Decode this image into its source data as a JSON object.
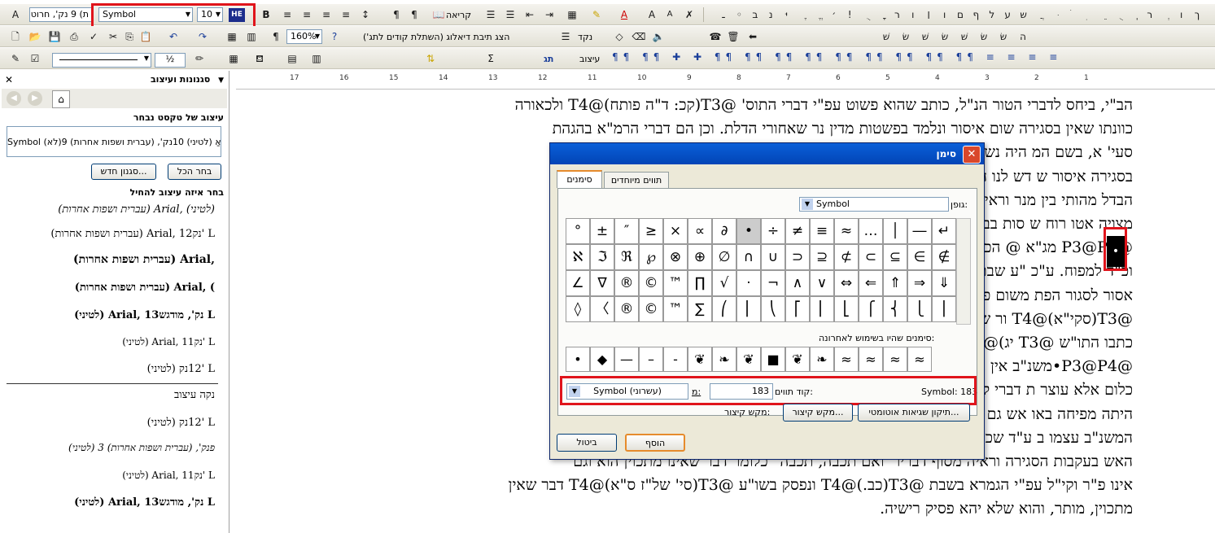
{
  "toolbar1": {
    "style_combo": "ת) 9 נק', חרוט",
    "font_combo": "Symbol",
    "size_combo": "10",
    "lang_button": "HE",
    "bold_label": "B",
    "read_label": "קריאה",
    "symbol_glyphs": [
      "ـ",
      "◦",
      "ב",
      "נ",
      "יּ",
      "ֶ",
      "ֱ",
      "׳",
      "!",
      "ֻ",
      "ׇ",
      "ר",
      "ו",
      "׀",
      "ו",
      "ם",
      "ף",
      "ל",
      "ע",
      "ש",
      "ֲ",
      "ּ",
      "ׄ",
      "ׅ",
      "ֵ",
      "ֻ",
      "ֽ",
      "ר",
      "ְ",
      "ו",
      "ך"
    ]
  },
  "toolbar2": {
    "zoom_combo": "160%",
    "paragraph_mark": "¶",
    "dialog_tip": "הצג תיבת דיאלוג (השתלת קודים לתג')",
    "nikud_label": "נקד",
    "shin_glyphs": [
      "שׁ",
      "שׂ",
      "שׁ",
      "שׂ",
      "שׁ",
      "שׂ",
      "שׂ",
      "ה"
    ]
  },
  "toolbar3": {
    "line_combo": "",
    "half_label": "½",
    "style_label": "עיצוב",
    "tag_label": "תג"
  },
  "pane": {
    "title": "סגנונות ועיצוב",
    "selected_heading": "עיצוב של טקסט נבחר",
    "selected_value": "Symbol (לא)אַ (לטיני) 10נק', (עברית ושפות אחרות) 9",
    "new_style_button": "סגנון חדש...",
    "select_all_button": "בחר הכל",
    "apply_heading": "בחר איזה עיצוב להחיל",
    "styles": [
      "(עברית ושפות אחרות) Arial, (לטיני)",
      "(עברית ושפות אחרות) Arial, 12נק' L",
      "(עברית ושפות אחרות) Arial,",
      "(עברית ושפות אחרות) Arial, (",
      "(לטיני) Arial, 13נק', מודגש L",
      "(לטיני) Arial, 11נק' L",
      "(לטיני) 12נק' L",
      "נקה עיצוב",
      "(לטיני) 12נק' L",
      "(לטיני) פנק', (עברית ושפות אחרות) 3",
      "(לטיני) Arial, 11נק' L",
      "(לטיני) Arial, 13נק', מודגש L"
    ]
  },
  "ruler": {
    "numbers": [
      "17",
      "16",
      "15",
      "14",
      "13",
      "12",
      "11",
      "10",
      "9",
      "8",
      "7",
      "6",
      "5",
      "4",
      "3",
      "2",
      "1"
    ]
  },
  "document": {
    "lines": [
      "הב\"י, ביחס לדברי הטור הנ\"ל, כותב שהוא פשוט עפ\"י דברי התוס' @T3(קכ: ד\"ה פותח)@T4 ולכאורה",
      "כוונתו שאין בסגירה שום איסור ונלמד בפשטות מדין נר שאחורי הדלת. וכן הם דברי הרמ\"א בהגהת",
      "סעי' א, בשם המ                                                        היה נשאר פתוח היה נכבה אין",
      "בסגירה איסור ש                                                        דש לנו הטור בדבריו, ובפרט שיש",
      "הבדל מהותי בין                                                        מנר וראיה שגוזרים במדורה רוח",
      "מצויה אטו רוח ש                                                       סות בביאור הדברים, כדלקמן :",
      "@P3@P4 מג\"א @                                                         הכא שרי, דבבית יש אויר הרבה",
      "וכ\"ד למפוח. ע\"כ                                                        \"ע שבתנור שיש בו גחלים לוחשות",
      "אסור לסגור הפת                                                        משום פסיק רישא [סי' רנ\"ט מג\"א",
      "@T3(סקי\"א)@T4                                                          ור שאין זה מכבה. וראיתי שכן",
      "כתבו התו\"ש @T3                                                          יג)@T4.",
      "@P3@P4•משנ\"ב                                                          אין בו משום מכבה שאינו עושה",
      "כלום אלא עוצר                                                          ת דברי קדשו, אם כוונתו שהרוח",
      "היתה מפיחה באו                                                          אש גם אם לא תכבה @T3(כמ\"ש",
      "המשנ\"ב עצמו ב                                                          ע\"ד שכוונתו שאין ודאות שתכבה",
      "האש בעקבות הסגירה וראיה מסוף דבריו \"ואם תכבה, תכבה\" כלומר דבר שאינו מתכוין הוא וגם",
      "אינו פ\"ר וקי\"ל עפ\"י הגמרא בשבת @T3(כב.)@T4 ונפסק בשו\"ע @T3(סי' של\"ז ס\"א)@T4 דבר שאין",
      "מתכוין, מותר, והוא שלא יהא פסיק רישיה."
    ]
  },
  "dialog": {
    "title": "סימן",
    "tab_symbols": "סימנים",
    "tab_special": "תווים מיוחדים",
    "font_label": "גופן:",
    "font_value": "Symbol",
    "grid": [
      [
        "°",
        "±",
        "″",
        "≥",
        "×",
        "∝",
        "∂",
        "•",
        "÷",
        "≠",
        "≡",
        "≈",
        "…",
        "│",
        "―",
        "↵"
      ],
      [
        "ℵ",
        "ℑ",
        "ℜ",
        "℘",
        "⊗",
        "⊕",
        "∅",
        "∩",
        "∪",
        "⊃",
        "⊇",
        "⊄",
        "⊂",
        "⊆",
        "∈",
        "∉"
      ],
      [
        "∠",
        "∇",
        "®",
        "©",
        "™",
        "∏",
        "√",
        "·",
        "¬",
        "∧",
        "∨",
        "⇔",
        "⇐",
        "⇑",
        "⇒",
        "⇓"
      ],
      [
        "◊",
        "〈",
        "®",
        "©",
        "™",
        "∑",
        "⎛",
        "⎜",
        "⎝",
        "⎡",
        "⎢",
        "⎣",
        "⎧",
        "⎨",
        "⎩",
        "⎪"
      ]
    ],
    "recent_label": "סימנים שהיו בשימוש לאחרונה:",
    "recent": [
      "•",
      "◆",
      "—",
      "–",
      "-",
      "❦",
      "❧",
      "❦",
      "■",
      "❦",
      "❧",
      "≈",
      "≈",
      "≈",
      "≈"
    ],
    "char_name": "Symbol: 183",
    "code_label": "קוד תווים:",
    "code_value": "183",
    "from_label": "מ:",
    "from_value": "Symbol (עשרוני)",
    "autocorrect_button": "תיקון שגיאות אוטומטי...",
    "shortcut_button": "מקש קיצור...",
    "shortcut_label": "מקש קיצור:",
    "insert_button": "הוסף",
    "cancel_button": "ביטול"
  },
  "doc_side_bullet": "•"
}
